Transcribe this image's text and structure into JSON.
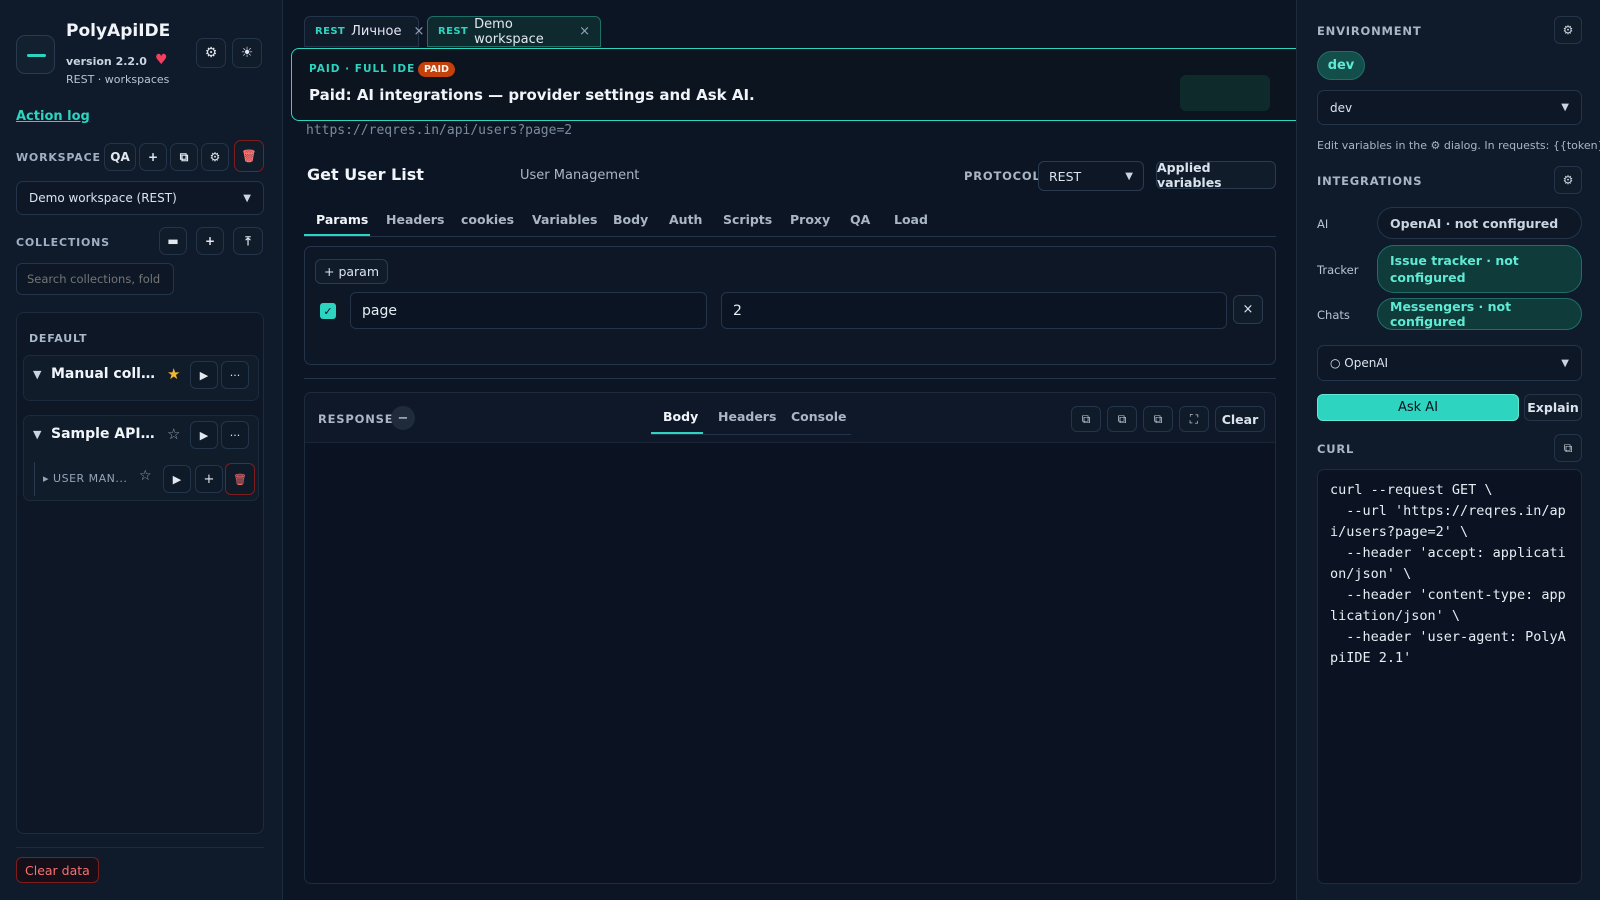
{
  "app": {
    "title": "PolyApiIDE",
    "version": "version 2.2.0",
    "subtitle": "REST · workspaces",
    "action_log": "Action log"
  },
  "workspace": {
    "label": "WORKSPACE",
    "qa_label": "QA",
    "add": "+",
    "selected": "Demo workspace (REST)"
  },
  "collections": {
    "label": "COLLECTIONS",
    "add": "+",
    "search_placeholder": "Search collections, fold",
    "group_label": "DEFAULT",
    "items": [
      {
        "name": "Manual collec...",
        "starred": "★",
        "run": "▶",
        "more": "···"
      },
      {
        "name": "Sample API C...",
        "starred": "☆",
        "run": "▶",
        "more": "···",
        "folder": {
          "name": "USER MAN...",
          "star": "☆",
          "run": "▶",
          "add": "+"
        }
      }
    ]
  },
  "sidebar_footer": {
    "clear_data": "Clear data"
  },
  "tabs": [
    {
      "proto": "REST",
      "label": "Личное",
      "close": "×"
    },
    {
      "proto": "REST",
      "label": "Demo workspace",
      "close": "×"
    }
  ],
  "banner": {
    "kicker": "PAID · FULL IDE",
    "badge": "PAID",
    "title": "Paid: AI integrations — provider settings and Ask AI."
  },
  "request": {
    "url": "https://reqres.in/api/users?page=2",
    "title": "Get User List",
    "folder": "User Management",
    "protocol_label": "PROTOCOL",
    "protocol": "REST",
    "applied_variables": "Applied variables",
    "tabs": [
      "Params",
      "Headers",
      "cookies",
      "Variables",
      "Body",
      "Auth",
      "Scripts",
      "Proxy",
      "QA",
      "Load"
    ],
    "add_param": "+ param",
    "params": [
      {
        "key": "page",
        "value": "2",
        "enabled": "✓",
        "delete": "×"
      }
    ]
  },
  "response": {
    "label": "RESPONSE",
    "collapse": "−",
    "tabs": [
      "Body",
      "Headers",
      "Console"
    ],
    "clear": "Clear"
  },
  "environment": {
    "label": "ENVIRONMENT",
    "current_pill": "dev",
    "selected": "dev",
    "hint": "Edit variables in the ⚙ dialog. In requests: {{token}}."
  },
  "integrations": {
    "label": "INTEGRATIONS",
    "rows": [
      {
        "label": "AI",
        "status": "OpenAI · not configured"
      },
      {
        "label": "Tracker",
        "status": "Issue tracker · not configured"
      },
      {
        "label": "Chats",
        "status": "Messengers · not configured"
      }
    ],
    "provider_selected": "○ OpenAI",
    "ask_ai": "Ask AI",
    "explain": "Explain"
  },
  "curl": {
    "label": "CURL",
    "text": "curl --request GET \\\n  --url 'https://reqres.in/api/users?page=2' \\\n  --header 'accept: application/json' \\\n  --header 'content-type: application/json' \\\n  --header 'user-agent: PolyApiIDE 2.1'"
  },
  "icons": {
    "logo": "logo-icon",
    "heart": "heart-icon",
    "gear": "gear-icon",
    "sun": "sun-icon",
    "trash": "trash-icon",
    "copy": "copy-icon",
    "folder": "folder-icon",
    "upload": "upload-icon",
    "expand": "fullscreen-icon",
    "caret": "caret-down-icon",
    "play": "play-icon"
  },
  "colors": {
    "accent": "#2dd4bf",
    "danger": "#f87171",
    "paid": "#c2410c",
    "background": "#0c1524"
  }
}
